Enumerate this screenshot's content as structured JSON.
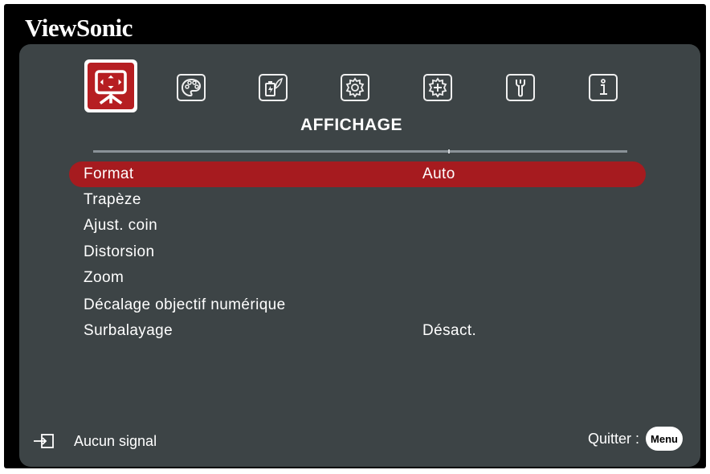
{
  "brand": "ViewSonic",
  "tabs": [
    {
      "icon": "display-icon",
      "active": true
    },
    {
      "icon": "palette-icon",
      "active": false
    },
    {
      "icon": "power-management-icon",
      "active": false
    },
    {
      "icon": "basic-settings-icon",
      "active": false
    },
    {
      "icon": "advanced-settings-icon",
      "active": false
    },
    {
      "icon": "wrench-icon",
      "active": false
    },
    {
      "icon": "info-icon",
      "active": false
    }
  ],
  "section_title": "AFFICHAGE",
  "menu": [
    {
      "label": "Format",
      "value": "Auto",
      "selected": true
    },
    {
      "label": "Trapèze",
      "value": ""
    },
    {
      "label": "Ajust. coin",
      "value": ""
    },
    {
      "label": "Distorsion",
      "value": ""
    },
    {
      "label": "Zoom",
      "value": ""
    },
    {
      "label": "Décalage objectif numérique",
      "value": ""
    },
    {
      "label": "Surbalayage",
      "value": "Désact."
    }
  ],
  "footer": {
    "source_icon": "input-source-icon",
    "status": "Aucun signal",
    "exit_label": "Quitter :",
    "menu_button": "Menu"
  },
  "colors": {
    "panel": "#3d4446",
    "accent": "#a61b1f",
    "active_tab": "#b61e22"
  }
}
